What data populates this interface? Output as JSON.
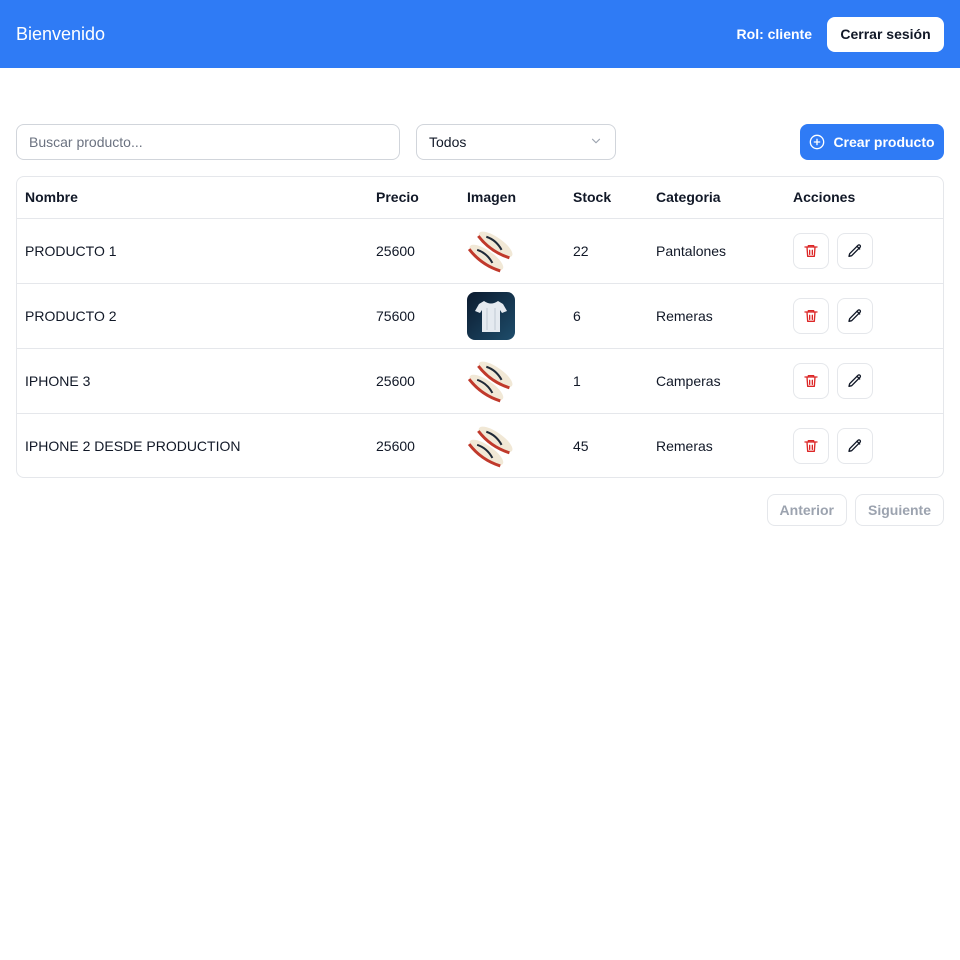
{
  "header": {
    "title": "Bienvenido",
    "role_label": "Rol: cliente",
    "logout_label": "Cerrar sesión",
    "bg_color": "#2f7bf5"
  },
  "toolbar": {
    "search_placeholder": "Buscar producto...",
    "search_value": "",
    "category_selected": "Todos",
    "create_label": "Crear producto"
  },
  "table": {
    "columns": [
      "Nombre",
      "Precio",
      "Imagen",
      "Stock",
      "Categoria",
      "Acciones"
    ],
    "rows": [
      {
        "nombre": "PRODUCTO 1",
        "precio": "25600",
        "imagen": "sneaker-image",
        "stock": "22",
        "categoria": "Pantalones"
      },
      {
        "nombre": "PRODUCTO 2",
        "precio": "75600",
        "imagen": "tshirt-image",
        "stock": "6",
        "categoria": "Remeras"
      },
      {
        "nombre": "IPHONE 3",
        "precio": "25600",
        "imagen": "sneaker-image",
        "stock": "1",
        "categoria": "Camperas"
      },
      {
        "nombre": "IPHONE 2 DESDE PRODUCTION",
        "precio": "25600",
        "imagen": "sneaker-image",
        "stock": "45",
        "categoria": "Remeras"
      }
    ],
    "delete_icon": "trash-icon",
    "edit_icon": "pencil-icon",
    "delete_color": "#dc2626"
  },
  "pagination": {
    "prev_label": "Anterior",
    "next_label": "Siguiente"
  }
}
